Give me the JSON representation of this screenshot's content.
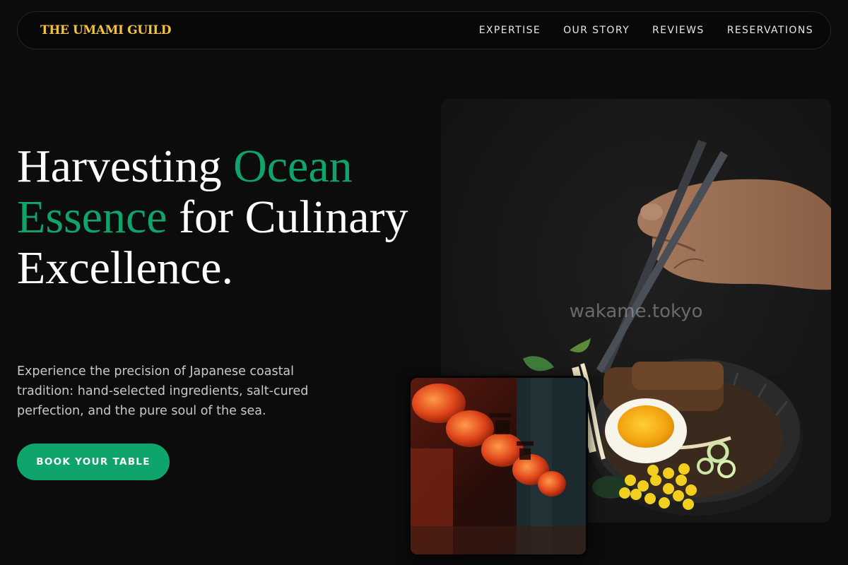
{
  "brand": {
    "name": "THE UMAMI GUILD",
    "accent_color": "#0fa46c",
    "logo_color": "#f5c33a"
  },
  "nav": {
    "links": [
      {
        "label": "EXPERTISE"
      },
      {
        "label": "OUR STORY"
      },
      {
        "label": "REVIEWS"
      },
      {
        "label": "RESERVATIONS"
      }
    ]
  },
  "hero": {
    "title_parts": [
      {
        "text": "Harvesting ",
        "accent": false
      },
      {
        "text": "Ocean Essence",
        "accent": true
      },
      {
        "text": " for Culinary Excellence.",
        "accent": false
      }
    ],
    "description": "Experience the precision of Japanese coastal tradition: hand-selected ingredients, salt-cured perfection, and the pure soul of the sea.",
    "cta_label": "BOOK YOUR TABLE"
  },
  "images": {
    "main_watermark": "wakame.tokyo",
    "main_icon": "ramen-bowl-chopsticks-photo",
    "inset_icon": "red-lanterns-photo"
  }
}
